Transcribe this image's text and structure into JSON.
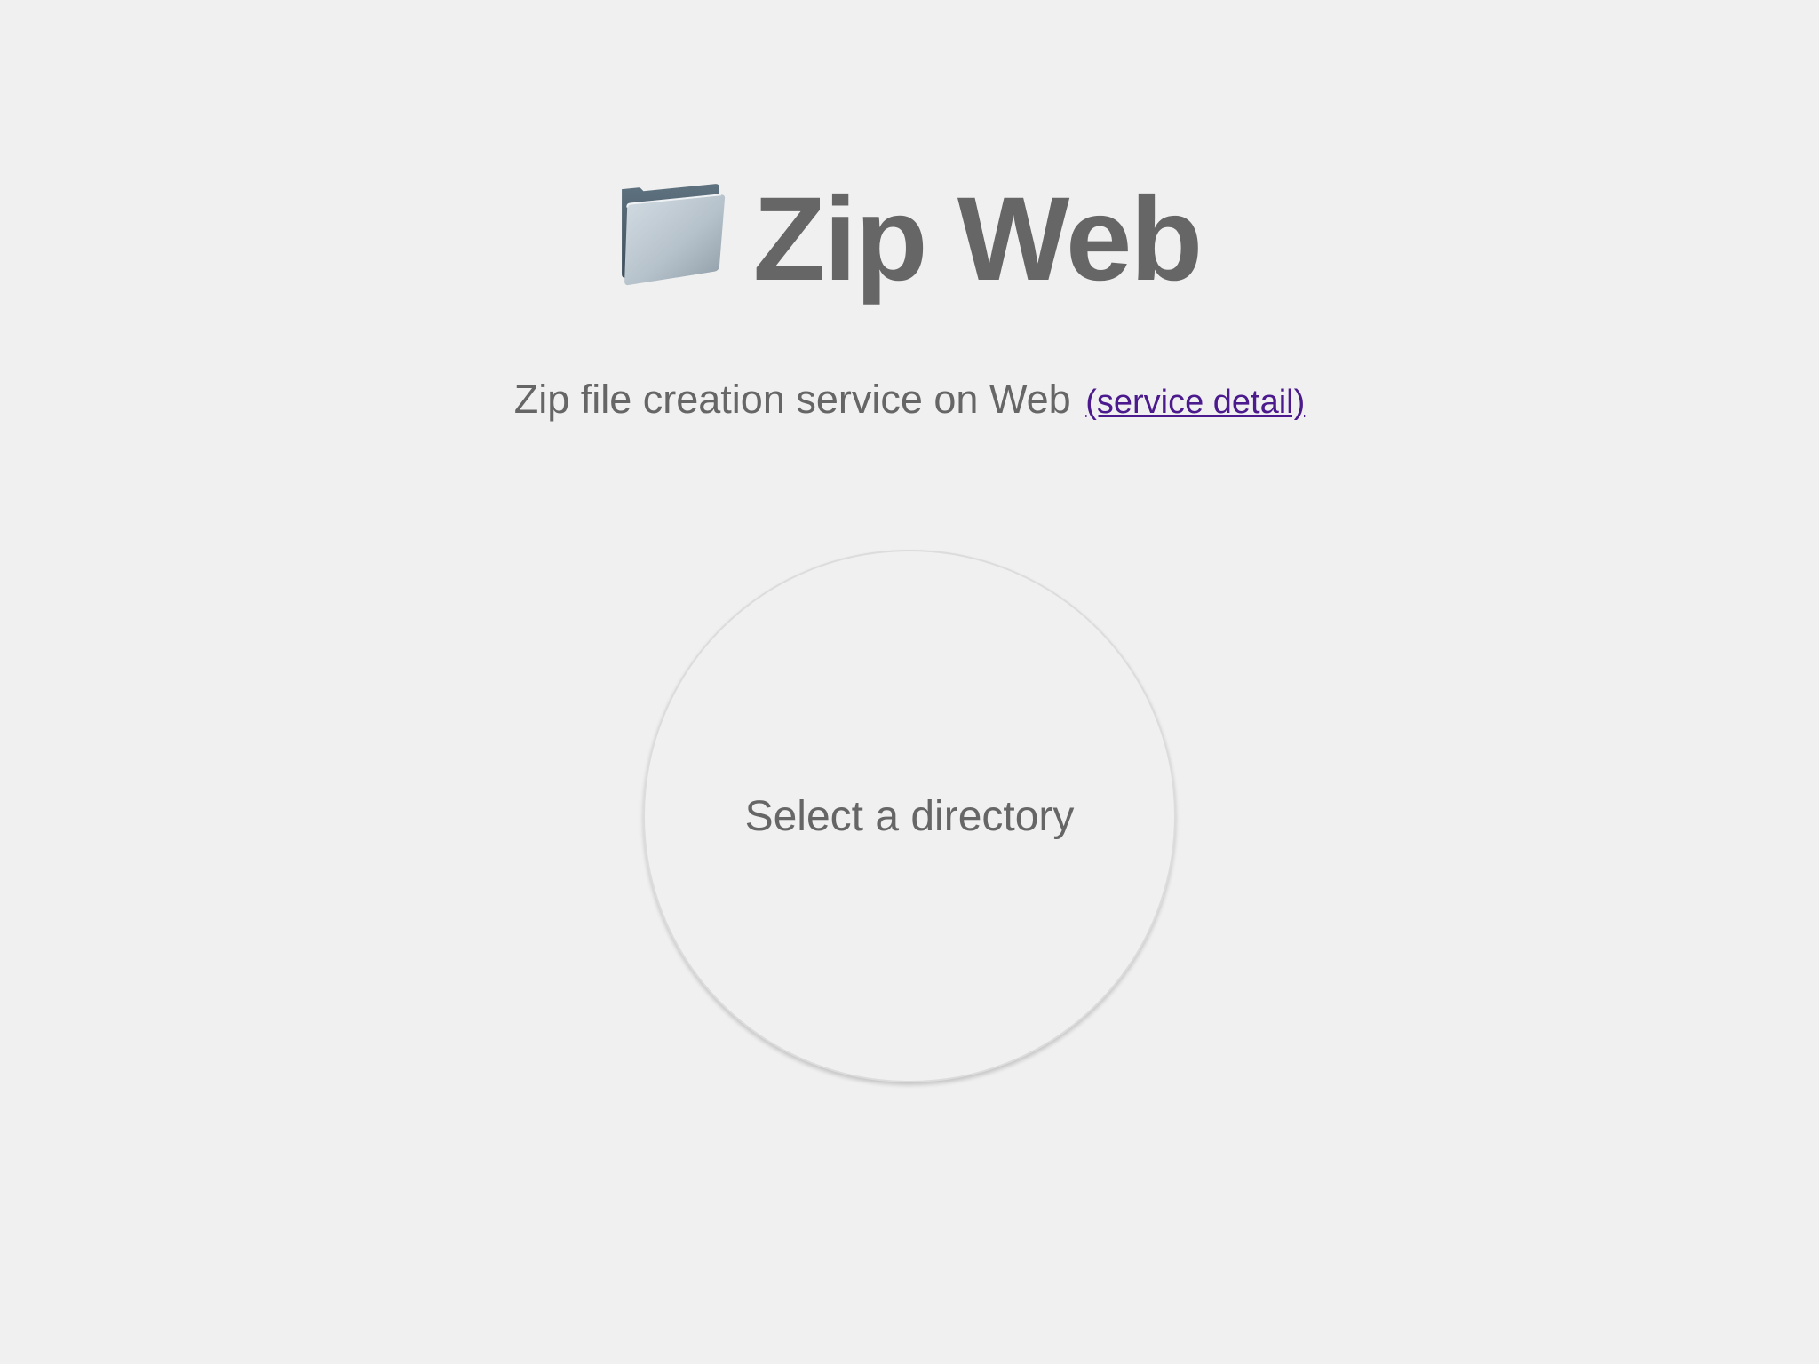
{
  "header": {
    "icon": "folder-icon",
    "title": "Zip Web"
  },
  "subtitle": {
    "text": "Zip file creation service on Web",
    "link_label": "(service detail)"
  },
  "select": {
    "label": "Select a directory"
  },
  "colors": {
    "background": "#f0f0f0",
    "text": "#666666",
    "link": "#4b1a8c"
  }
}
